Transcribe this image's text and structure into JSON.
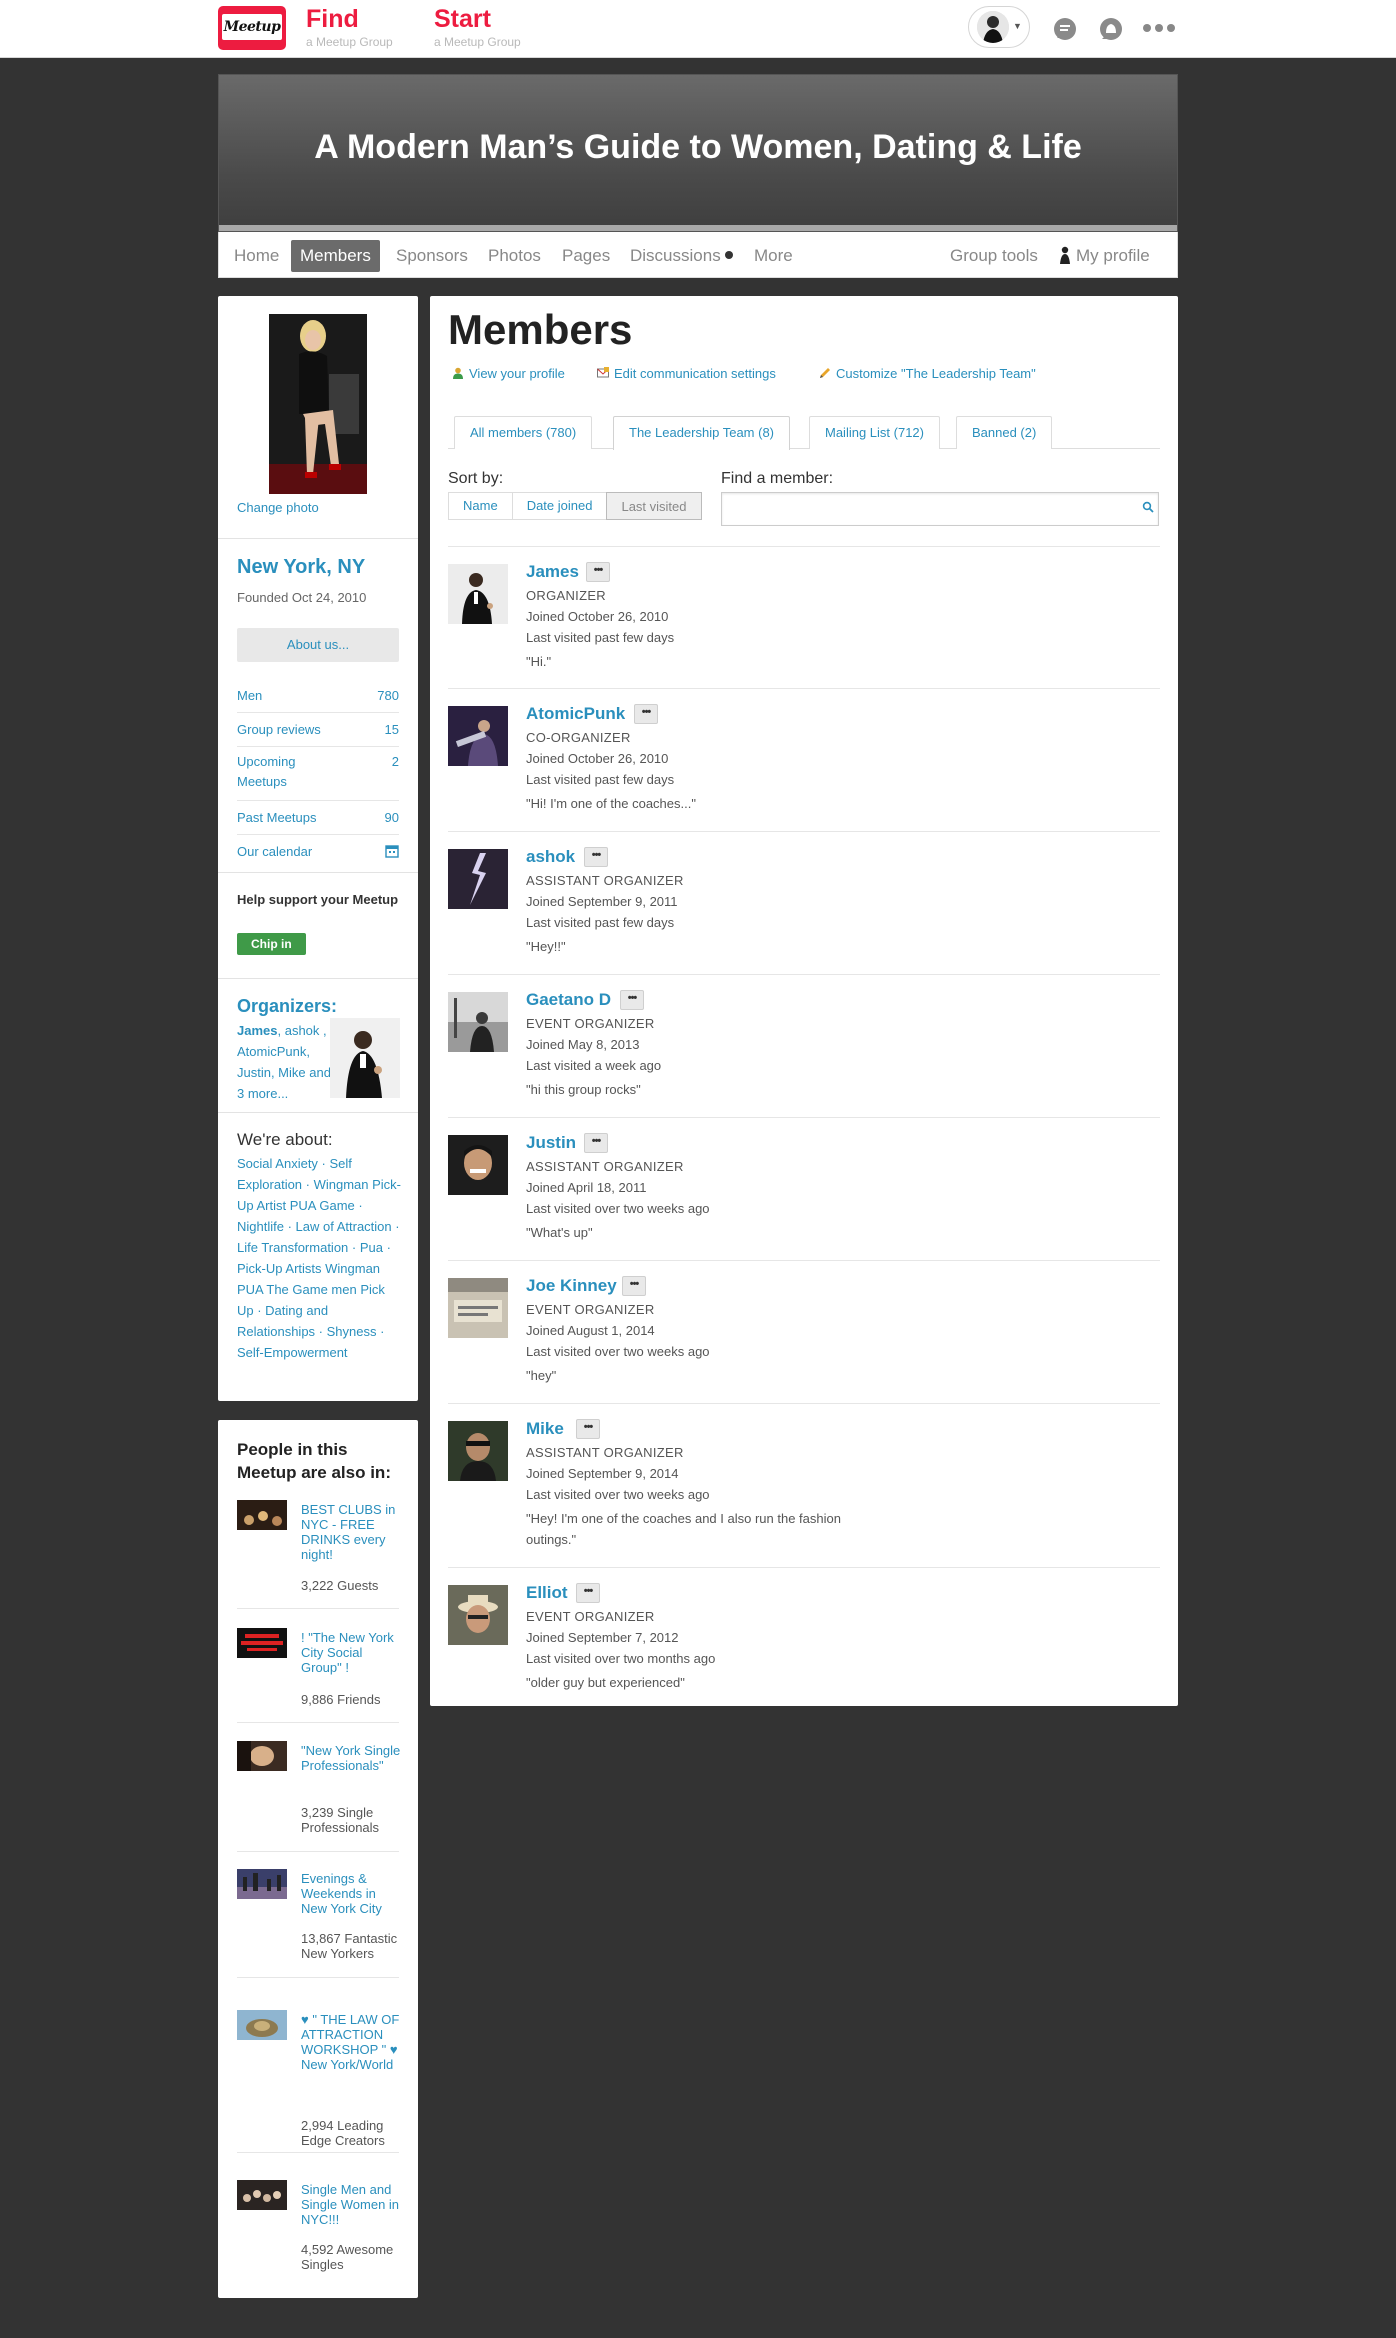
{
  "nav": {
    "logo_text": "Meetup",
    "find_label": "Find",
    "find_sub": "a Meetup Group",
    "start_label": "Start",
    "start_sub": "a Meetup Group"
  },
  "group": {
    "title": "A Modern Man’s Guide to Women, Dating & Life",
    "tabs": [
      "Home",
      "Members",
      "Sponsors",
      "Photos",
      "Pages",
      "Discussions",
      "More"
    ],
    "active_tab": "Members",
    "group_tools": "Group tools",
    "my_profile": "My profile"
  },
  "sidebar": {
    "change_photo": "Change photo",
    "city": "New York, NY",
    "founded": "Founded Oct 24, 2010",
    "about_btn": "About us...",
    "stats": [
      {
        "label": "Men",
        "value": "780"
      },
      {
        "label": "Group reviews",
        "value": "15"
      },
      {
        "label": "Upcoming Meetups",
        "value": "2"
      },
      {
        "label": "Past Meetups",
        "value": "90"
      },
      {
        "label": "Our calendar",
        "value": ""
      }
    ],
    "support_text": "Help support your Meetup",
    "chip_in": "Chip in",
    "organizers_title": "Organizers:",
    "organizers_lead": "James",
    "organizers_rest": ", ashok , AtomicPunk, Justin, Mike and 3 more...",
    "about_title": "We're about:",
    "about_tags": "Social Anxiety · Self Exploration · Wingman Pick-Up Artist PUA Game · Nightlife · Law of Attraction · Life Transformation · Pua · Pick-Up Artists Wingman PUA The Game men Pick Up · Dating and Relationships · Shyness · Self-Empowerment"
  },
  "also_in": {
    "title": "People in this Meetup are also in:",
    "items": [
      {
        "name": "BEST CLUBS in NYC - FREE DRINKS every night!",
        "count": "3,222 Guests",
        "thumb_color": "#2b1d14"
      },
      {
        "name": "! \"The New York City Social Group\" !",
        "count": "9,886 Friends",
        "thumb_color": "#111111"
      },
      {
        "name": "\"New York Single Professionals\"",
        "count": "3,239 Single Professionals",
        "thumb_color": "#3b2b22"
      },
      {
        "name": "Evenings & Weekends in New York City",
        "count": "13,867 Fantastic New Yorkers",
        "thumb_color": "#3a3f6a"
      },
      {
        "name": "♥ \" THE LAW OF ATTRACTION WORKSHOP \" ♥ New York/World",
        "count": "2,994 Leading Edge Creators",
        "thumb_color": "#8d7a50"
      },
      {
        "name": "Single Men and Single Women in NYC!!!",
        "count": "4,592 Awesome Singles",
        "thumb_color": "#2a2422"
      }
    ]
  },
  "main": {
    "title": "Members",
    "links": [
      {
        "label": "View your profile"
      },
      {
        "label": "Edit communication settings"
      },
      {
        "label": "Customize \"The Leadership Team\""
      }
    ],
    "tabs": [
      {
        "label": "All members (780)"
      },
      {
        "label": "The Leadership Team (8)"
      },
      {
        "label": "Mailing List (712)"
      },
      {
        "label": "Banned (2)"
      }
    ],
    "active_tab": "The Leadership Team (8)",
    "sort_label": "Sort by:",
    "sort_options": [
      "Name",
      "Date joined",
      "Last visited"
    ],
    "sort_selected": "Last visited",
    "find_label": "Find a member:",
    "find_value": "",
    "members": [
      {
        "name": "James",
        "role": "ORGANIZER",
        "joined": "Joined October 26, 2010",
        "visited": "Last visited past few days",
        "quote": "\"Hi.\"",
        "thumb_color": "#e8e8e8"
      },
      {
        "name": "AtomicPunk",
        "role": "CO-ORGANIZER",
        "joined": "Joined October 26, 2010",
        "visited": "Last visited past few days",
        "quote": "\"Hi! I'm one of the coaches...\"",
        "thumb_color": "#3a2a4a"
      },
      {
        "name": "ashok",
        "role": "ASSISTANT ORGANIZER",
        "joined": "Joined September 9, 2011",
        "visited": "Last visited past few days",
        "quote": "\"Hey!!\"",
        "thumb_color": "#2a2334"
      },
      {
        "name": "Gaetano D",
        "role": "EVENT ORGANIZER",
        "joined": "Joined May 8, 2013",
        "visited": "Last visited a week ago",
        "quote": "\"hi this group rocks\"",
        "thumb_color": "#9a9a9a"
      },
      {
        "name": "Justin",
        "role": "ASSISTANT ORGANIZER",
        "joined": "Joined April 18, 2011",
        "visited": "Last visited over two weeks ago",
        "quote": "\"What's up\"",
        "thumb_color": "#1d1d1d"
      },
      {
        "name": "Joe Kinney",
        "role": "EVENT ORGANIZER",
        "joined": "Joined August 1, 2014",
        "visited": "Last visited over two weeks ago",
        "quote": "\"hey\"",
        "thumb_color": "#c9c2b3"
      },
      {
        "name": "Mike",
        "role": "ASSISTANT ORGANIZER",
        "joined": "Joined September 9, 2014",
        "visited": "Last visited over two weeks ago",
        "quote": "\"Hey! I'm one of the coaches and I also run the fashion outings.\"",
        "thumb_color": "#2f3a2a"
      },
      {
        "name": "Elliot",
        "role": "EVENT ORGANIZER",
        "joined": "Joined September 7, 2012",
        "visited": "Last visited over two months ago",
        "quote": "\"older guy but experienced\"",
        "thumb_color": "#8a7a6a"
      }
    ]
  },
  "colors": {
    "brand_red": "#ed1c40",
    "link_blue": "#2a8fbd",
    "chip_green": "#3f9a48"
  }
}
